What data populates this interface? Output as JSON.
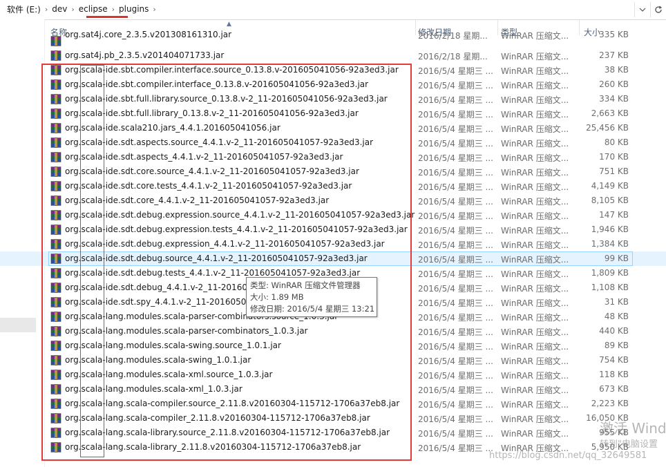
{
  "address_bar": {
    "crumbs": [
      "软件 (E:)",
      "dev",
      "eclipse",
      "plugins"
    ],
    "separator": "›"
  },
  "columns": {
    "name": "名称",
    "date": "修改日期",
    "type": "类型",
    "size": "大小"
  },
  "files": [
    {
      "name": "org.sat4j.core_2.3.5.v201308161310.jar",
      "date": "2016/2/18 星期...",
      "type": "WinRAR 压缩文...",
      "size": "335 KB"
    },
    {
      "name": "org.sat4j.pb_2.3.5.v201404071733.jar",
      "date": "2016/2/18 星期...",
      "type": "WinRAR 压缩文...",
      "size": "237 KB"
    },
    {
      "name": "org.scala-ide.sbt.compiler.interface.source_0.13.8.v-201605041056-92a3ed3.jar",
      "date": "2016/5/4 星期三 ...",
      "type": "WinRAR 压缩文...",
      "size": "38 KB"
    },
    {
      "name": "org.scala-ide.sbt.compiler.interface_0.13.8.v-201605041056-92a3ed3.jar",
      "date": "2016/5/4 星期三 ...",
      "type": "WinRAR 压缩文...",
      "size": "260 KB"
    },
    {
      "name": "org.scala-ide.sbt.full.library.source_0.13.8.v-2_11-201605041056-92a3ed3.jar",
      "date": "2016/5/4 星期三 ...",
      "type": "WinRAR 压缩文...",
      "size": "334 KB"
    },
    {
      "name": "org.scala-ide.sbt.full.library_0.13.8.v-2_11-201605041056-92a3ed3.jar",
      "date": "2016/5/4 星期三 ...",
      "type": "WinRAR 压缩文...",
      "size": "2,663 KB"
    },
    {
      "name": "org.scala-ide.scala210.jars_4.4.1.201605041056.jar",
      "date": "2016/5/4 星期三 ...",
      "type": "WinRAR 压缩文...",
      "size": "25,456 KB"
    },
    {
      "name": "org.scala-ide.sdt.aspects.source_4.4.1.v-2_11-201605041057-92a3ed3.jar",
      "date": "2016/5/4 星期三 ...",
      "type": "WinRAR 压缩文...",
      "size": "80 KB"
    },
    {
      "name": "org.scala-ide.sdt.aspects_4.4.1.v-2_11-201605041057-92a3ed3.jar",
      "date": "2016/5/4 星期三 ...",
      "type": "WinRAR 压缩文...",
      "size": "170 KB"
    },
    {
      "name": "org.scala-ide.sdt.core.source_4.4.1.v-2_11-201605041057-92a3ed3.jar",
      "date": "2016/5/4 星期三 ...",
      "type": "WinRAR 压缩文...",
      "size": "751 KB"
    },
    {
      "name": "org.scala-ide.sdt.core.tests_4.4.1.v-2_11-201605041057-92a3ed3.jar",
      "date": "2016/5/4 星期三 ...",
      "type": "WinRAR 压缩文...",
      "size": "4,149 KB"
    },
    {
      "name": "org.scala-ide.sdt.core_4.4.1.v-2_11-201605041057-92a3ed3.jar",
      "date": "2016/5/4 星期三 ...",
      "type": "WinRAR 压缩文...",
      "size": "8,105 KB"
    },
    {
      "name": "org.scala-ide.sdt.debug.expression.source_4.4.1.v-2_11-201605041057-92a3ed3.jar",
      "date": "2016/5/4 星期三 ...",
      "type": "WinRAR 压缩文...",
      "size": "147 KB"
    },
    {
      "name": "org.scala-ide.sdt.debug.expression.tests_4.4.1.v-2_11-201605041057-92a3ed3.jar",
      "date": "2016/5/4 星期三 ...",
      "type": "WinRAR 压缩文...",
      "size": "1,946 KB"
    },
    {
      "name": "org.scala-ide.sdt.debug.expression_4.4.1.v-2_11-201605041057-92a3ed3.jar",
      "date": "2016/5/4 星期三 ...",
      "type": "WinRAR 压缩文...",
      "size": "1,384 KB"
    },
    {
      "name": "org.scala-ide.sdt.debug.source_4.4.1.v-2_11-201605041057-92a3ed3.jar",
      "date": "2016/5/4 星期三 ...",
      "type": "WinRAR 压缩文...",
      "size": "99 KB"
    },
    {
      "name": "org.scala-ide.sdt.debug.tests_4.4.1.v-2_11-201605041057-92a3ed3.jar",
      "date": "2016/5/4 星期三 ...",
      "type": "WinRAR 压缩文...",
      "size": "1,809 KB"
    },
    {
      "name": "org.scala-ide.sdt.debug_4.4.1.v-2_11-2016050",
      "date": "2016/5/4 星期三 ...",
      "type": "WinRAR 压缩文...",
      "size": "1,108 KB"
    },
    {
      "name": "org.scala-ide.sdt.spy_4.4.1.v-2_11-2016050411",
      "date": "2016/5/4 星期三 ...",
      "type": "WinRAR 压缩文...",
      "size": "31 KB"
    },
    {
      "name": "org.scala-lang.modules.scala-parser-combinators.source_1.0.3.jar",
      "date": "2016/5/4 星期三 ...",
      "type": "WinRAR 压缩文...",
      "size": "48 KB"
    },
    {
      "name": "org.scala-lang.modules.scala-parser-combinators_1.0.3.jar",
      "date": "2016/5/4 星期三 ...",
      "type": "WinRAR 压缩文...",
      "size": "440 KB"
    },
    {
      "name": "org.scala-lang.modules.scala-swing.source_1.0.1.jar",
      "date": "2016/5/4 星期三 ...",
      "type": "WinRAR 压缩文...",
      "size": "89 KB"
    },
    {
      "name": "org.scala-lang.modules.scala-swing_1.0.1.jar",
      "date": "2016/5/4 星期三 ...",
      "type": "WinRAR 压缩文...",
      "size": "754 KB"
    },
    {
      "name": "org.scala-lang.modules.scala-xml.source_1.0.3.jar",
      "date": "2016/5/4 星期三 ...",
      "type": "WinRAR 压缩文...",
      "size": "118 KB"
    },
    {
      "name": "org.scala-lang.modules.scala-xml_1.0.3.jar",
      "date": "2016/5/4 星期三 ...",
      "type": "WinRAR 压缩文...",
      "size": "673 KB"
    },
    {
      "name": "org.scala-lang.scala-compiler.source_2.11.8.v20160304-115712-1706a37eb8.jar",
      "date": "2016/5/4 星期三 ...",
      "type": "WinRAR 压缩文...",
      "size": "2,223 KB"
    },
    {
      "name": "org.scala-lang.scala-compiler_2.11.8.v20160304-115712-1706a37eb8.jar",
      "date": "2016/5/4 星期三 ...",
      "type": "WinRAR 压缩文...",
      "size": "16,050 KB"
    },
    {
      "name": "org.scala-lang.scala-library.source_2.11.8.v20160304-115712-1706a37eb8.jar",
      "date": "2016/5/4 星期三 ...",
      "type": "WinRAR 压缩文...",
      "size": "955 KB"
    },
    {
      "name": "org.scala-lang.scala-library_2.11.8.v20160304-115712-1706a37eb8.jar",
      "date": "2016/5/4 星期三 ...",
      "type": "WinRAR 压缩文...",
      "size": "5,950 KB"
    }
  ],
  "tooltip": {
    "type_line": "类型: WinRAR 压缩文件管理器",
    "size_line": "大小: 1.89 MB",
    "date_line": "修改日期: 2016/5/4 星期三 13:21"
  },
  "watermarks": {
    "activate": "激活 Wind",
    "settings": "转到\"电脑设置",
    "blog": "https://blog.csdn.net/qq_32649581"
  },
  "colors": {
    "highlight_box": "#e23a3a",
    "selected_row": "#e5f3ff"
  }
}
